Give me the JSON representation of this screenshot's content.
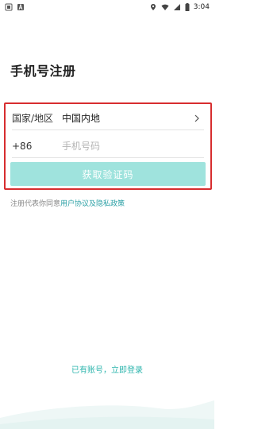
{
  "status_bar": {
    "time": "3:04",
    "icons": [
      "screenshot-icon",
      "text-a-icon",
      "location-icon",
      "wifi-icon",
      "signal-icon",
      "battery-icon"
    ]
  },
  "title": "手机号注册",
  "region": {
    "label": "国家/地区",
    "value": "中国内地"
  },
  "phone": {
    "country_code": "+86",
    "placeholder": "手机号码",
    "value": ""
  },
  "get_code_button": "获取验证码",
  "agreement": {
    "prefix": "注册代表你同意",
    "user_agreement": "用户协议",
    "and": "及",
    "privacy_policy": "隐私政策"
  },
  "login_link": "已有账号，立即登录",
  "colors": {
    "accent": "#2db5ad",
    "button_disabled": "#9fe3dd",
    "highlight_border": "#d72d2f",
    "link": "#2da1a6"
  }
}
